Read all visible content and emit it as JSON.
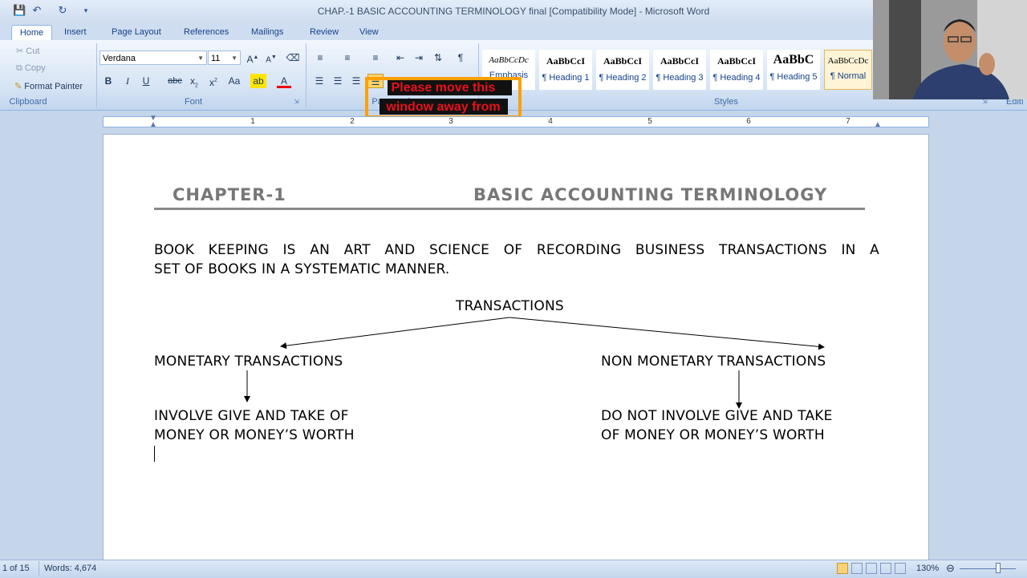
{
  "window": {
    "title": "CHAP.-1 BASIC ACCOUNTING TERMINOLOGY final [Compatibility Mode] - Microsoft Word"
  },
  "quick_access": {
    "save_icon": "save-icon",
    "undo_icon": "undo-icon",
    "redo_icon": "redo-icon",
    "customize_icon": "customize-icon"
  },
  "tabs": [
    "Home",
    "Insert",
    "Page Layout",
    "References",
    "Mailings",
    "Review",
    "View"
  ],
  "clipboard": {
    "cut": "Cut",
    "copy": "Copy",
    "format_painter": "Format Painter",
    "label": "Clipboard"
  },
  "font": {
    "name": "Verdana",
    "size": "11",
    "label": "Font"
  },
  "paragraph": {
    "label": "Paragraph"
  },
  "styles": {
    "label": "Styles",
    "items": [
      {
        "sample": "AaBbCcDc",
        "name": "Emphasis"
      },
      {
        "sample": "AaBbCcI",
        "name": "¶ Heading 1"
      },
      {
        "sample": "AaBbCcI",
        "name": "¶ Heading 2"
      },
      {
        "sample": "AaBbCcI",
        "name": "¶ Heading 3"
      },
      {
        "sample": "AaBbCcI",
        "name": "¶ Heading 4"
      },
      {
        "sample": "AaBbC",
        "name": "¶ Heading 5"
      },
      {
        "sample": "AaBbCcDc",
        "name": "¶ Normal"
      }
    ]
  },
  "editing": {
    "label": "Editi"
  },
  "popup": {
    "line1": "Please move this",
    "line2": "window away from"
  },
  "ruler": {
    "numbers": [
      "1",
      "2",
      "3",
      "4",
      "5",
      "6",
      "7"
    ]
  },
  "document": {
    "chapter": "CHAPTER-1",
    "title": "BASIC ACCOUNTING TERMINOLOGY",
    "definition_line1": "BOOK KEEPING IS AN ART AND SCIENCE OF RECORDING BUSINESS TRANSACTIONS IN A",
    "definition_line2": "SET OF BOOKS IN A SYSTEMATIC MANNER.",
    "transactions": "TRANSACTIONS",
    "monetary": "MONETARY TRANSACTIONS",
    "non_monetary": "NON MONETARY TRANSACTIONS",
    "monetary_desc_line1": "INVOLVE GIVE AND TAKE OF",
    "monetary_desc_line2": "MONEY OR MONEY’S WORTH",
    "non_monetary_desc_line1": "DO NOT INVOLVE GIVE AND TAKE",
    "non_monetary_desc_line2": "OF MONEY OR MONEY’S WORTH"
  },
  "status": {
    "page": "1 of 15",
    "words": "Words: 4,674",
    "zoom": "130%"
  }
}
